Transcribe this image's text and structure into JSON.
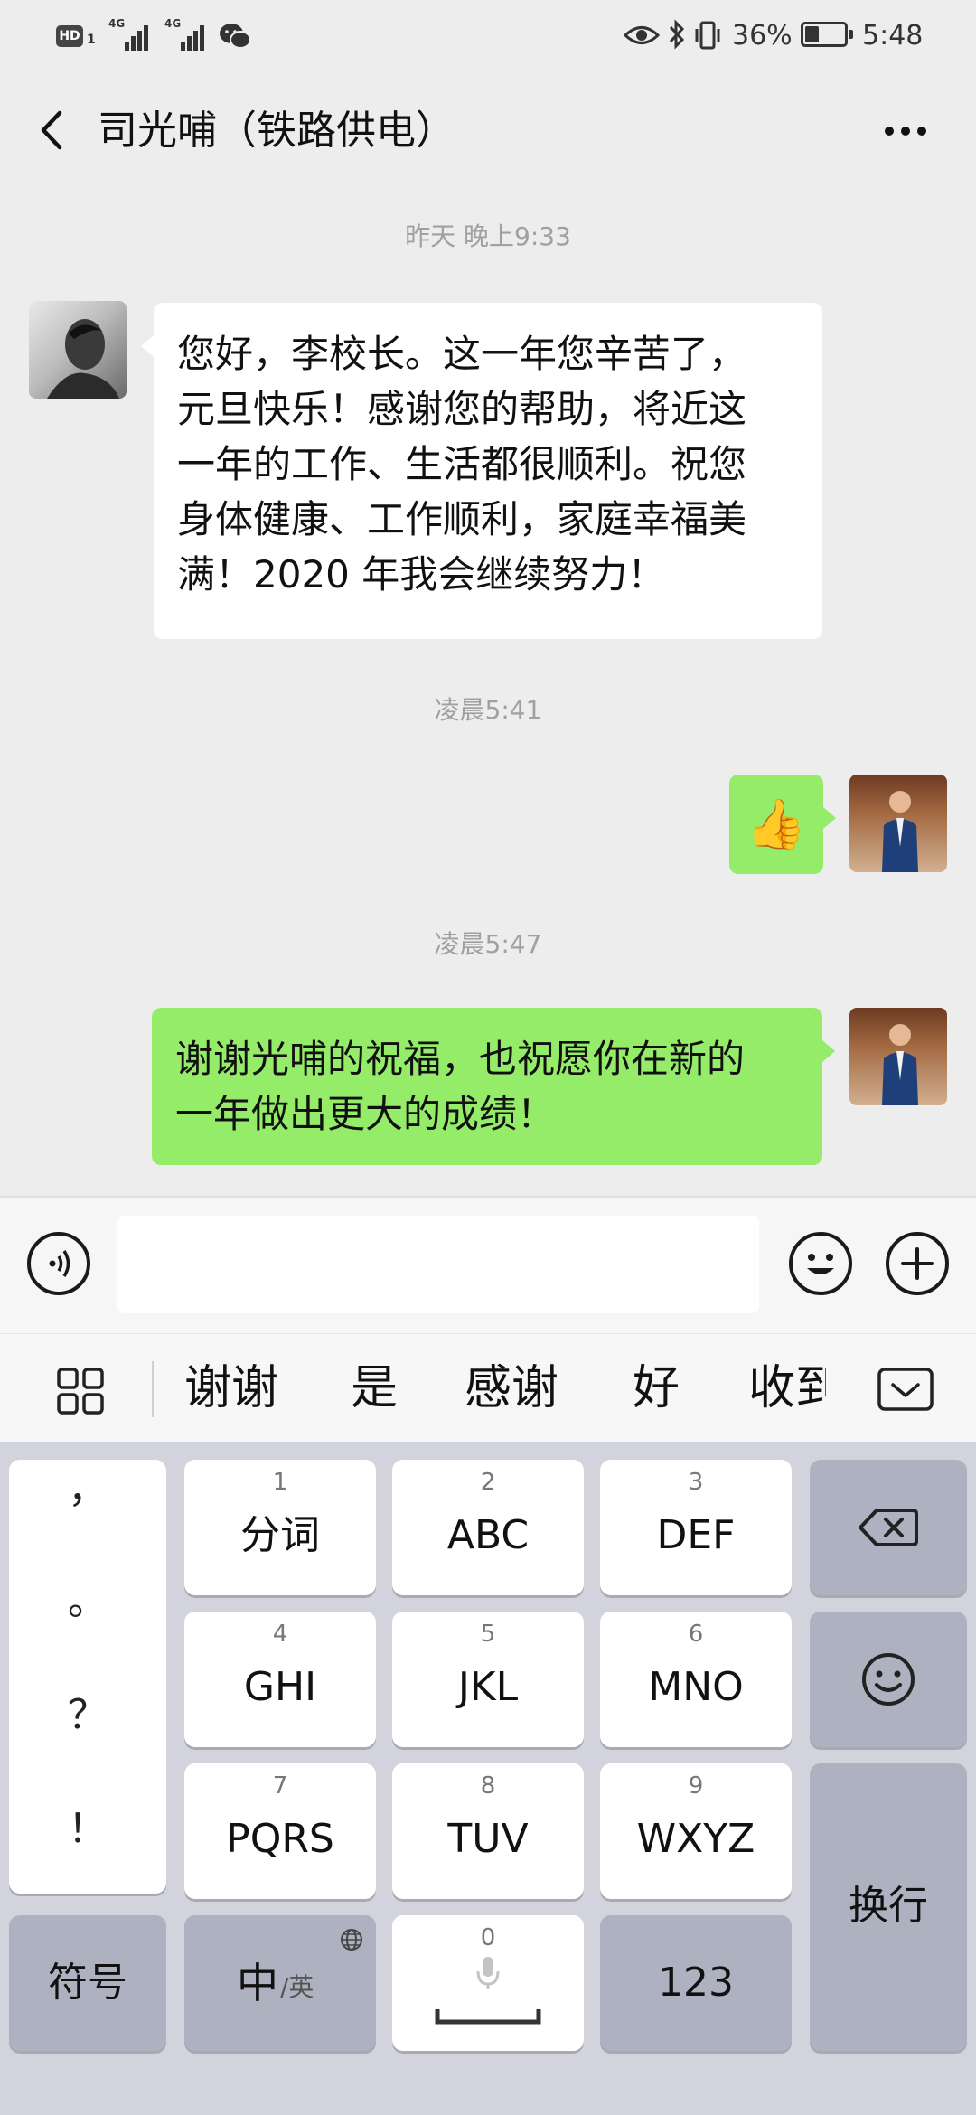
{
  "status_bar": {
    "hd": "HD",
    "sim1": "1",
    "net1": "4G",
    "net2": "4G",
    "battery": "36%",
    "battery_level": 0.36,
    "time": "5:48",
    "icons": [
      "wechat-icon",
      "eye-icon",
      "bluetooth-icon",
      "vibrate-icon",
      "battery-icon"
    ]
  },
  "header": {
    "title": "司光哺（铁路供电）",
    "back_icon": "chevron-left-icon",
    "more_icon": "more-dots-icon"
  },
  "messages": [
    {
      "type": "timestamp",
      "text": "昨天 晚上9:33"
    },
    {
      "type": "text",
      "side": "left",
      "sender": "contact",
      "lines": [
        "您好，李校长。这一年您辛苦了，",
        "元旦快乐！感谢您的帮助，将近这",
        "一年的工作、生活都很顺利。祝您",
        "身体健康、工作顺利，家庭幸福美",
        "满！2020 年我会继续努力！"
      ]
    },
    {
      "type": "timestamp",
      "text": "凌晨5:41"
    },
    {
      "type": "emoji",
      "side": "right",
      "sender": "me",
      "emoji": "👍"
    },
    {
      "type": "timestamp",
      "text": "凌晨5:47"
    },
    {
      "type": "text",
      "side": "right",
      "sender": "me",
      "lines": [
        "谢谢光哺的祝福，也祝愿你在新的",
        "一年做出更大的成绩！"
      ]
    }
  ],
  "input_bar": {
    "voice_icon": "voice-icon",
    "value": "",
    "placeholder": "",
    "emoji_icon": "smiley-icon",
    "plus_icon": "plus-icon"
  },
  "candidates": {
    "grid_icon": "grid-icon",
    "words": [
      "谢谢",
      "是",
      "感谢",
      "好",
      "收到"
    ],
    "fold_icon": "keyboard-collapse-icon"
  },
  "keyboard": {
    "punctuation": [
      "，",
      "。",
      "？",
      "！"
    ],
    "keys": [
      {
        "num": "1",
        "label": "分词"
      },
      {
        "num": "2",
        "label": "ABC"
      },
      {
        "num": "3",
        "label": "DEF"
      },
      {
        "num": "4",
        "label": "GHI"
      },
      {
        "num": "5",
        "label": "JKL"
      },
      {
        "num": "6",
        "label": "MNO"
      },
      {
        "num": "7",
        "label": "PQRS"
      },
      {
        "num": "8",
        "label": "TUV"
      },
      {
        "num": "9",
        "label": "WXYZ"
      }
    ],
    "delete_icon": "backspace-icon",
    "emoji_icon": "smiley-icon",
    "enter_label": "换行",
    "symbols_label": "符号",
    "lang_main": "中",
    "lang_alt": "/英",
    "lang_icon": "globe-icon",
    "space_num": "0",
    "mic_icon": "microphone-icon",
    "numbers_label": "123"
  }
}
